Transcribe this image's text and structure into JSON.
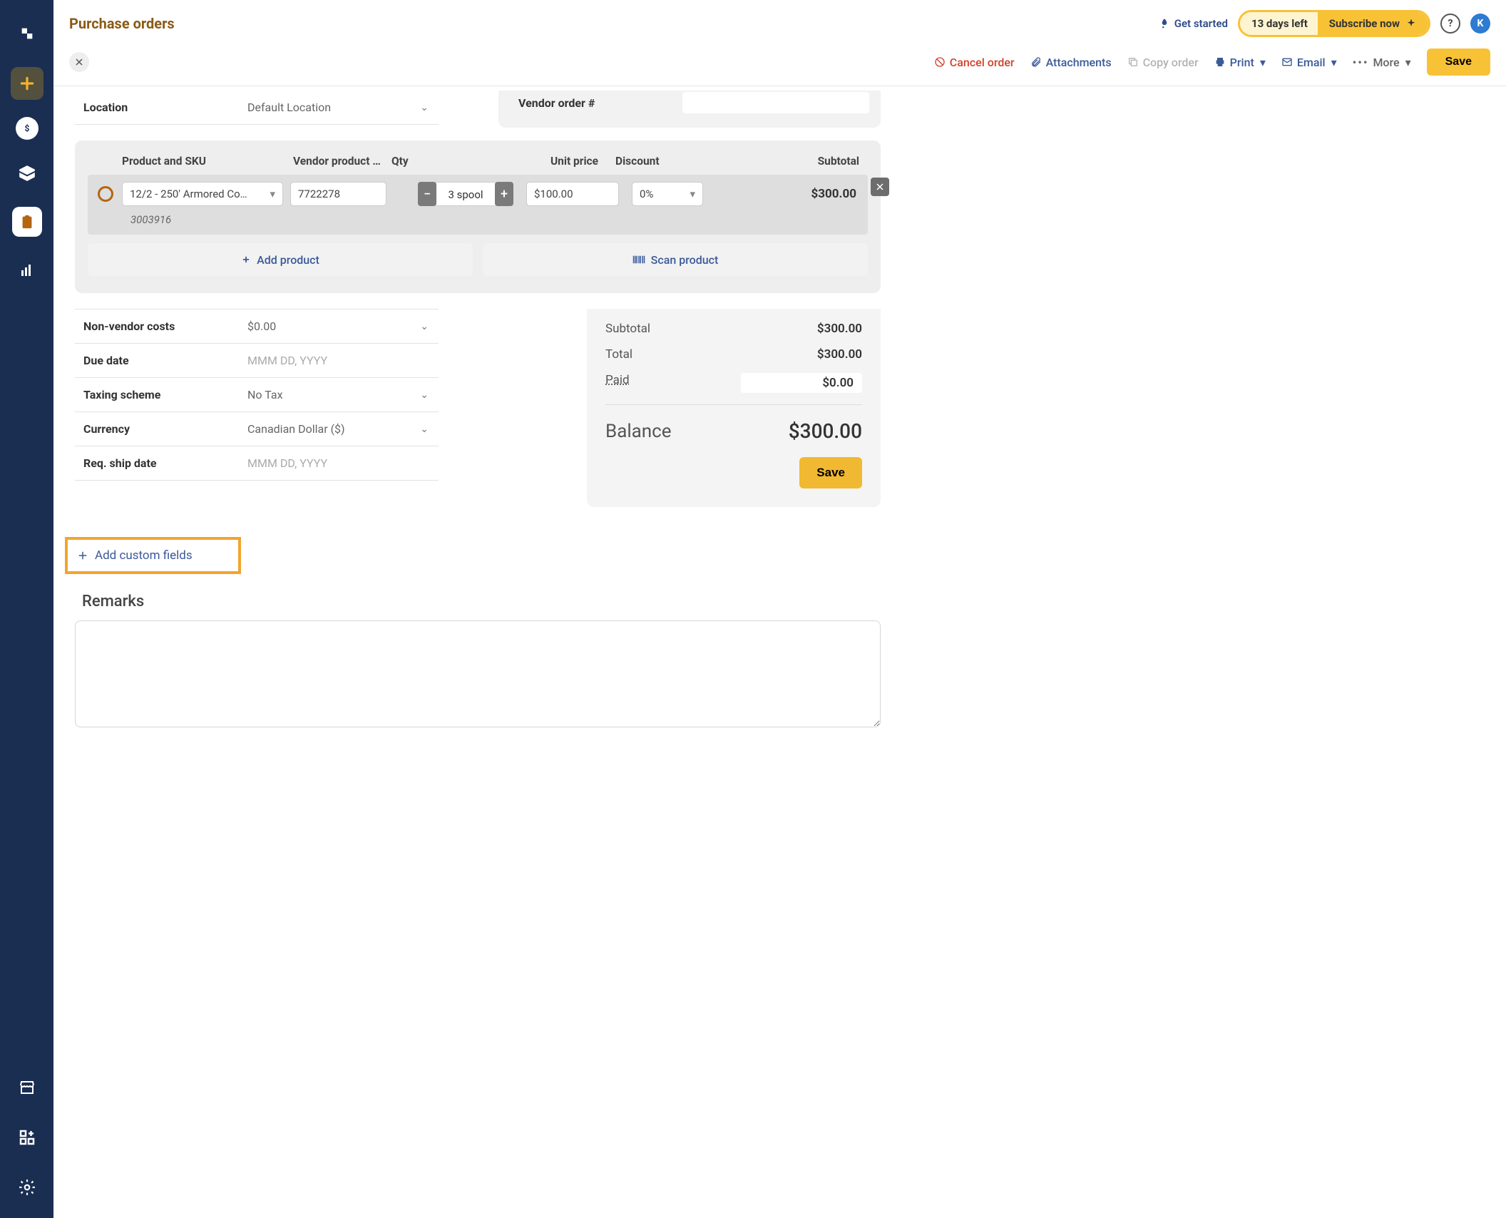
{
  "header": {
    "title": "Purchase orders",
    "get_started": "Get started",
    "trial_left": "13 days left",
    "subscribe": "Subscribe now",
    "avatar_letter": "K"
  },
  "actions": {
    "cancel": "Cancel order",
    "attachments": "Attachments",
    "copy": "Copy order",
    "print": "Print",
    "email": "Email",
    "more": "More",
    "save": "Save"
  },
  "top_fields": {
    "location_label": "Location",
    "location_value": "Default Location",
    "vendor_order_label": "Vendor order #"
  },
  "items": {
    "columns": {
      "product": "Product and SKU",
      "vendor_product": "Vendor product …",
      "qty": "Qty",
      "unit_price": "Unit price",
      "discount": "Discount",
      "subtotal": "Subtotal"
    },
    "rows": [
      {
        "product": "12/2 - 250' Armored Co…",
        "vendor_product": "7722278",
        "qty": "3 spool",
        "unit_price": "$100.00",
        "discount": "0%",
        "subtotal": "$300.00",
        "sku": "3003916"
      }
    ],
    "add_product": "Add product",
    "scan_product": "Scan product"
  },
  "left_fields": {
    "nv_costs_label": "Non-vendor costs",
    "nv_costs_value": "$0.00",
    "due_date_label": "Due date",
    "date_placeholder": "MMM DD, YYYY",
    "taxing_label": "Taxing scheme",
    "taxing_value": "No Tax",
    "currency_label": "Currency",
    "currency_value": "Canadian Dollar ($)",
    "req_ship_label": "Req. ship date"
  },
  "summary": {
    "subtotal_label": "Subtotal",
    "subtotal_value": "$300.00",
    "total_label": "Total",
    "total_value": "$300.00",
    "paid_label": "Paid",
    "paid_value": "$0.00",
    "balance_label": "Balance",
    "balance_value": "$300.00",
    "save": "Save"
  },
  "add_custom_fields": "Add custom fields",
  "remarks": {
    "title": "Remarks",
    "value": ""
  }
}
